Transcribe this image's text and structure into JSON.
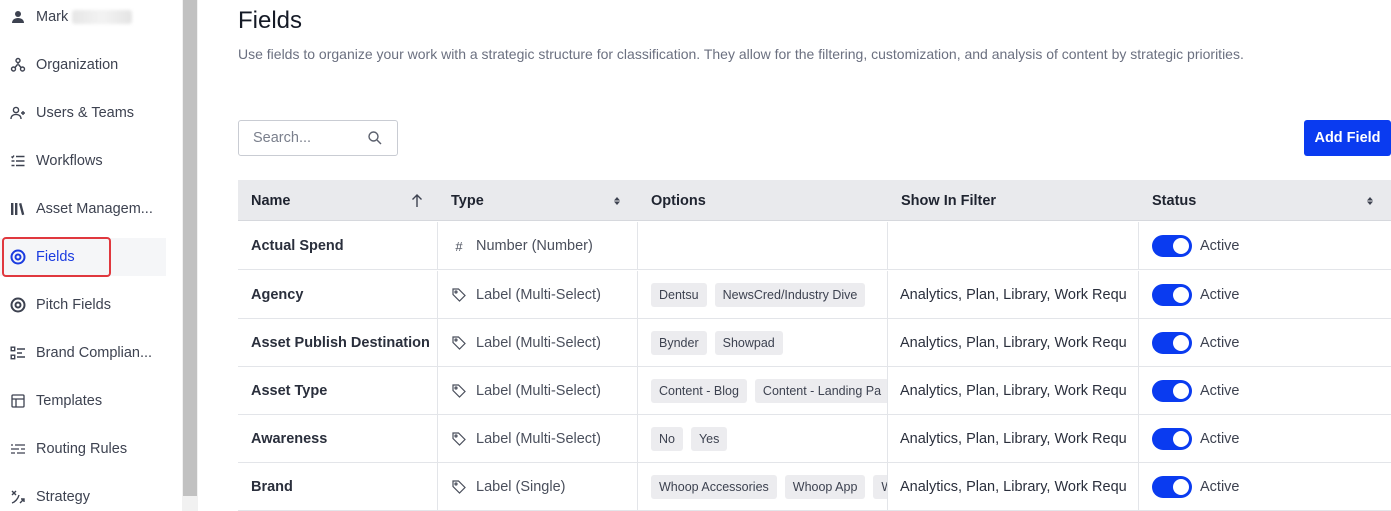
{
  "sidebar": {
    "user_name": "Mark",
    "items": [
      {
        "label": "Organization",
        "icon": "org-chart-icon"
      },
      {
        "label": "Users & Teams",
        "icon": "user-plus-icon"
      },
      {
        "label": "Workflows",
        "icon": "workflow-list-icon"
      },
      {
        "label": "Asset Managem...",
        "icon": "library-books-icon"
      },
      {
        "label": "Fields",
        "icon": "target-circle-icon",
        "active": true
      },
      {
        "label": "Pitch Fields",
        "icon": "target-circle-icon"
      },
      {
        "label": "Brand Complian...",
        "icon": "checklist-icon"
      },
      {
        "label": "Templates",
        "icon": "template-icon"
      },
      {
        "label": "Routing Rules",
        "icon": "routing-lines-icon"
      },
      {
        "label": "Strategy",
        "icon": "strategy-arrows-icon"
      }
    ]
  },
  "header": {
    "title": "Fields",
    "description": "Use fields to organize your work with a strategic structure for classification. They allow for the filtering, customization, and analysis of content by strategic priorities."
  },
  "toolbar": {
    "search_placeholder": "Search...",
    "add_label": "Add Field"
  },
  "table": {
    "columns": [
      "Name",
      "Type",
      "Options",
      "Show In Filter",
      "Status"
    ],
    "rows": [
      {
        "name": "Actual Spend",
        "type_icon": "#",
        "type": "Number (Number)",
        "options": [],
        "filter": "",
        "status": "Active"
      },
      {
        "name": "Agency",
        "type_icon": "tag",
        "type": "Label (Multi-Select)",
        "options": [
          "Dentsu",
          "NewsCred/Industry Dive"
        ],
        "filter": "Analytics, Plan, Library, Work Requ",
        "status": "Active"
      },
      {
        "name": "Asset Publish Destination",
        "type_icon": "tag",
        "type": "Label (Multi-Select)",
        "options": [
          "Bynder",
          "Showpad"
        ],
        "filter": "Analytics, Plan, Library, Work Requ",
        "status": "Active"
      },
      {
        "name": "Asset Type",
        "type_icon": "tag",
        "type": "Label (Multi-Select)",
        "options": [
          "Content - Blog",
          "Content - Landing Pa"
        ],
        "filter": "Analytics, Plan, Library, Work Requ",
        "status": "Active"
      },
      {
        "name": "Awareness",
        "type_icon": "tag",
        "type": "Label (Multi-Select)",
        "options": [
          "No",
          "Yes"
        ],
        "filter": "Analytics, Plan, Library, Work Requ",
        "status": "Active"
      },
      {
        "name": "Brand",
        "type_icon": "tag",
        "type": "Label (Single)",
        "options": [
          "Whoop Accessories",
          "Whoop App",
          "W"
        ],
        "filter": "Analytics, Plan, Library, Work Requ",
        "status": "Active"
      }
    ]
  },
  "colors": {
    "accent": "#0a3bf0",
    "active_nav": "#1a3be0",
    "highlight_outline": "#e0383e"
  }
}
